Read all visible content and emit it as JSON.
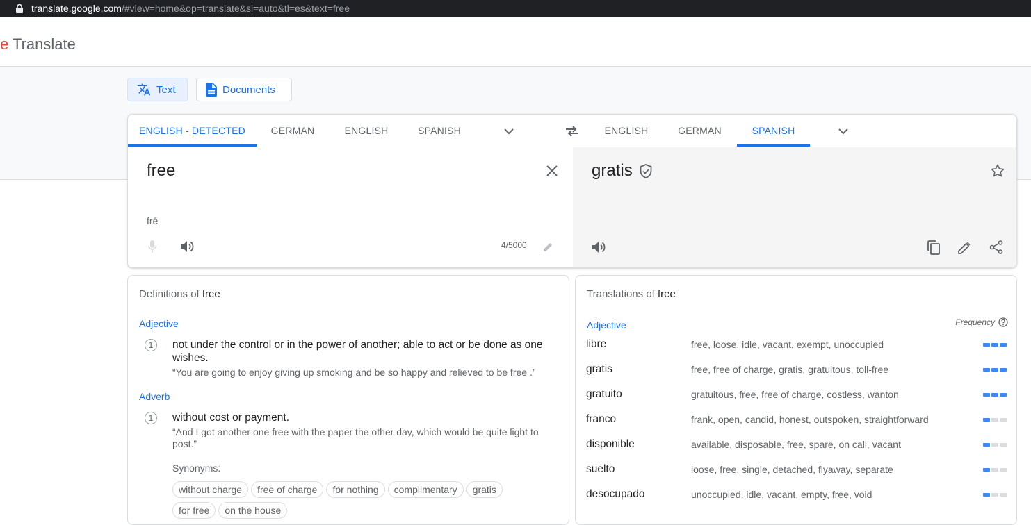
{
  "browser": {
    "url_host": "translate.google.com",
    "url_rest": "/#view=home&op=translate&sl=auto&tl=es&text=free"
  },
  "header": {
    "brand_partial": "e",
    "brand_title": "Translate"
  },
  "modes": {
    "text_label": "Text",
    "documents_label": "Documents"
  },
  "source_langs": [
    "ENGLISH - DETECTED",
    "GERMAN",
    "ENGLISH",
    "SPANISH"
  ],
  "target_langs": [
    "ENGLISH",
    "GERMAN",
    "SPANISH"
  ],
  "source": {
    "text": "free",
    "transliteration": "frē",
    "char_count": "4/5000"
  },
  "target": {
    "text": "gratis"
  },
  "definitions": {
    "title_prefix": "Definitions of",
    "word": "free",
    "groups": [
      {
        "pos": "Adjective",
        "number": "1",
        "definition": "not under the control or in the power of another; able to act or be done as one wishes.",
        "example": "“You are going to enjoy giving up smoking and be so happy and relieved to be free .”"
      },
      {
        "pos": "Adverb",
        "number": "1",
        "definition": "without cost or payment.",
        "example": "“And I got another one free with the paper the other day, which would be quite light to post.”"
      }
    ],
    "synonyms_label": "Synonyms:",
    "synonyms": [
      "without charge",
      "free of charge",
      "for nothing",
      "complimentary",
      "gratis",
      "for free",
      "on the house"
    ]
  },
  "translations": {
    "title_prefix": "Translations of",
    "word": "free",
    "pos": "Adjective",
    "frequency_label": "Frequency",
    "rows": [
      {
        "word": "libre",
        "reverse": "free, loose, idle, vacant, exempt, unoccupied",
        "frequency": 3
      },
      {
        "word": "gratis",
        "reverse": "free, free of charge, gratis, gratuitous, toll-free",
        "frequency": 3
      },
      {
        "word": "gratuito",
        "reverse": "gratuitous, free, free of charge, costless, wanton",
        "frequency": 3
      },
      {
        "word": "franco",
        "reverse": "frank, open, candid, honest, outspoken, straightforward",
        "frequency": 1
      },
      {
        "word": "disponible",
        "reverse": "available, disposable, free, spare, on call, vacant",
        "frequency": 1
      },
      {
        "word": "suelto",
        "reverse": "loose, free, single, detached, flyaway, separate",
        "frequency": 1
      },
      {
        "word": "desocupado",
        "reverse": "unoccupied, idle, vacant, empty, free, void",
        "frequency": 1
      }
    ]
  }
}
